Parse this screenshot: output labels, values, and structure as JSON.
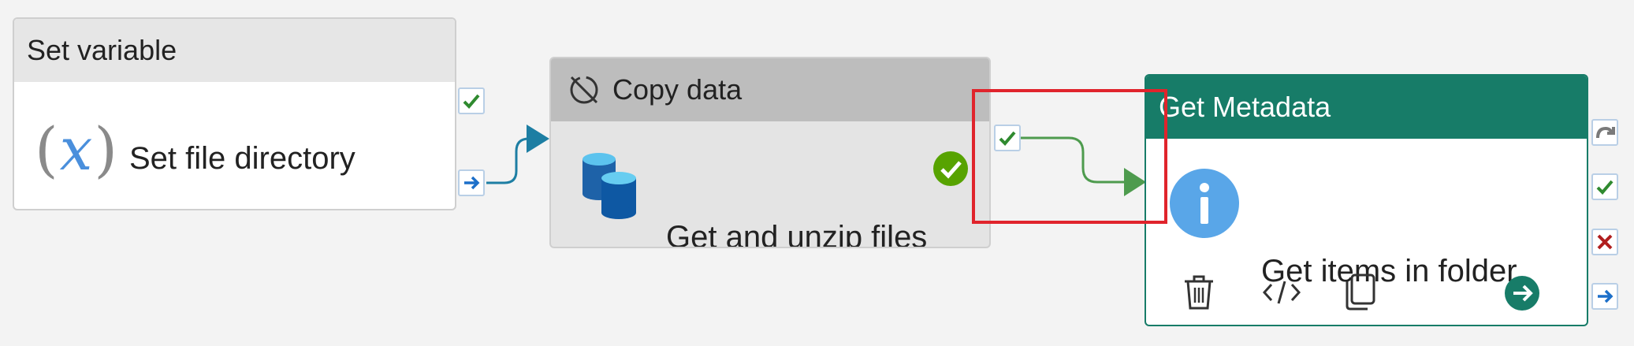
{
  "activities": {
    "set_variable": {
      "header": "Set variable",
      "label": "Set file directory",
      "icon": "variable-icon"
    },
    "copy_data": {
      "header": "Copy data",
      "label": "Get and unzip files",
      "icon": "database-icon",
      "status": "succeeded"
    },
    "get_metadata": {
      "header": "Get Metadata",
      "label": "Get items in folder",
      "icon": "info-icon",
      "actions": [
        "delete-icon",
        "code-icon",
        "copy-icon",
        "go-arrow-icon"
      ]
    }
  },
  "ports": [
    "skip-icon",
    "success-check-icon",
    "failure-x-icon",
    "completion-arrow-icon"
  ],
  "connectors": [
    {
      "from": "Set file directory",
      "to": "Get and unzip files",
      "type": "completion"
    },
    {
      "from": "Get and unzip files",
      "to": "Get items in folder",
      "type": "success"
    }
  ],
  "colors": {
    "canvas_bg": "#f3f3f3",
    "selected_header": "#177c68",
    "success_green": "#2f8a2f",
    "completion_blue": "#1c6fc9",
    "failure_red": "#b01e1e",
    "copy_connector": "#1d7ea3",
    "highlight": "#e0242c"
  }
}
